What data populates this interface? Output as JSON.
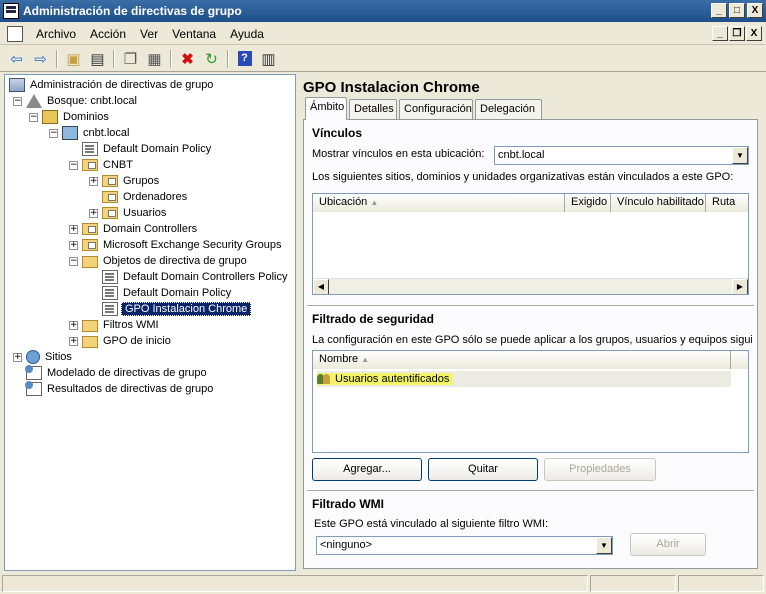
{
  "window": {
    "title": "Administración de directivas de grupo",
    "controls": {
      "minimize": "_",
      "restore": "□",
      "close": "X"
    }
  },
  "mdi_controls": {
    "minimize": "_",
    "restore": "❐",
    "close": "X"
  },
  "menu": [
    "Archivo",
    "Acción",
    "Ver",
    "Ventana",
    "Ayuda"
  ],
  "toolbar": [
    "back-icon",
    "forward-icon",
    "up-folder-icon",
    "show-hide-tree-icon",
    "copy-icon",
    "paste-icon",
    "delete-icon",
    "refresh-icon",
    "help-icon",
    "properties-icon"
  ],
  "tree": {
    "items": [
      {
        "label": "Administración de directivas de grupo",
        "depth": 0,
        "expander": "",
        "icon": "root"
      },
      {
        "label": "Bosque: cnbt.local",
        "depth": 1,
        "expander": "−",
        "icon": "forest"
      },
      {
        "label": "Dominios",
        "depth": 2,
        "expander": "−",
        "icon": "domains"
      },
      {
        "label": "cnbt.local",
        "depth": 3,
        "expander": "−",
        "icon": "domain"
      },
      {
        "label": "Default Domain Policy",
        "depth": 4,
        "expander": "",
        "icon": "gpo"
      },
      {
        "label": "CNBT",
        "depth": 4,
        "expander": "−",
        "icon": "ou"
      },
      {
        "label": "Grupos",
        "depth": 5,
        "expander": "+",
        "icon": "ou"
      },
      {
        "label": "Ordenadores",
        "depth": 5,
        "expander": "",
        "icon": "ou"
      },
      {
        "label": "Usuarios",
        "depth": 5,
        "expander": "+",
        "icon": "ou"
      },
      {
        "label": "Domain Controllers",
        "depth": 4,
        "expander": "+",
        "icon": "ou"
      },
      {
        "label": "Microsoft Exchange Security Groups",
        "depth": 4,
        "expander": "+",
        "icon": "ou"
      },
      {
        "label": "Objetos de directiva de grupo",
        "depth": 4,
        "expander": "−",
        "icon": "folder"
      },
      {
        "label": "Default Domain Controllers Policy",
        "depth": 5,
        "expander": "",
        "icon": "gpo"
      },
      {
        "label": "Default Domain Policy",
        "depth": 5,
        "expander": "",
        "icon": "gpo"
      },
      {
        "label": "GPO Instalacion Chrome",
        "depth": 5,
        "expander": "",
        "icon": "gpo",
        "selected": true
      },
      {
        "label": "Filtros WMI",
        "depth": 4,
        "expander": "+",
        "icon": "folder"
      },
      {
        "label": "GPO de inicio",
        "depth": 4,
        "expander": "+",
        "icon": "folder"
      },
      {
        "label": "Sitios",
        "depth": 1,
        "expander": "+",
        "icon": "sites"
      },
      {
        "label": "Modelado de directivas de grupo",
        "depth": 1,
        "expander": "",
        "icon": "model"
      },
      {
        "label": "Resultados de directivas de grupo",
        "depth": 1,
        "expander": "",
        "icon": "model"
      }
    ]
  },
  "details": {
    "title": "GPO Instalacion Chrome",
    "tabs": [
      "Ámbito",
      "Detalles",
      "Configuración",
      "Delegación"
    ],
    "links": {
      "heading": "Vínculos",
      "location_label": "Mostrar vínculos en esta ubicación:",
      "location_value": "cnbt.local",
      "description": "Los siguientes sitios, dominios y unidades organizativas están vinculados a este GPO:",
      "columns": [
        "Ubicación",
        "Exigido",
        "Vínculo habilitado",
        "Ruta"
      ]
    },
    "security": {
      "heading": "Filtrado de seguridad",
      "description": "La configuración en este GPO sólo se puede aplicar a los grupos, usuarios y equipos siguient",
      "column": "Nombre",
      "entries": [
        "Usuarios autentificados"
      ],
      "buttons": {
        "add": "Agregar...",
        "remove": "Quitar",
        "properties": "Propiedades"
      }
    },
    "wmi": {
      "heading": "Filtrado WMI",
      "description": "Este GPO está vinculado al siguiente filtro WMI:",
      "value": "<ninguno>",
      "open_button": "Abrir"
    }
  },
  "colors": {
    "title_bar": "#1f4e8a",
    "selection": "#0a246a",
    "highlight": "#f3f36a"
  }
}
